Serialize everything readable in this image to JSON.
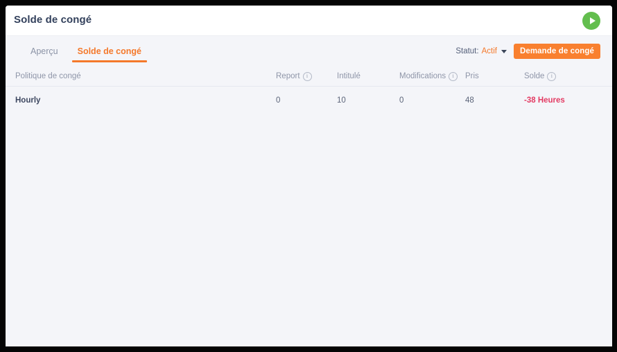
{
  "window": {
    "title": "Solde de congé"
  },
  "header": {
    "title": "Solde de congé",
    "play_button_icon": "play-icon"
  },
  "tabs": [
    {
      "label": "Aperçu",
      "active": false
    },
    {
      "label": "Solde de congé",
      "active": true
    }
  ],
  "toolbar": {
    "status_label": "Statut:",
    "status_value": "Actif",
    "caret_icon": "chevron-down-icon",
    "request_button_label": "Demande de congé"
  },
  "table": {
    "columns": [
      {
        "label": "Politique de congé",
        "info": false
      },
      {
        "label": "Report",
        "info": true
      },
      {
        "label": "Intitulé",
        "info": false
      },
      {
        "label": "Modifications",
        "info": true
      },
      {
        "label": "Pris",
        "info": false
      },
      {
        "label": "Solde",
        "info": true
      }
    ],
    "rows": [
      {
        "policy": "Hourly",
        "report": "0",
        "intitule": "10",
        "modifications": "0",
        "pris": "48",
        "solde": "-38 Heures"
      }
    ]
  },
  "colors": {
    "accent_orange": "#f4792b",
    "button_orange": "#f9802f",
    "play_green": "#63be4e",
    "negative_red": "#e33b63",
    "page_bg": "#f4f5f9",
    "title_navy": "#33415c"
  }
}
